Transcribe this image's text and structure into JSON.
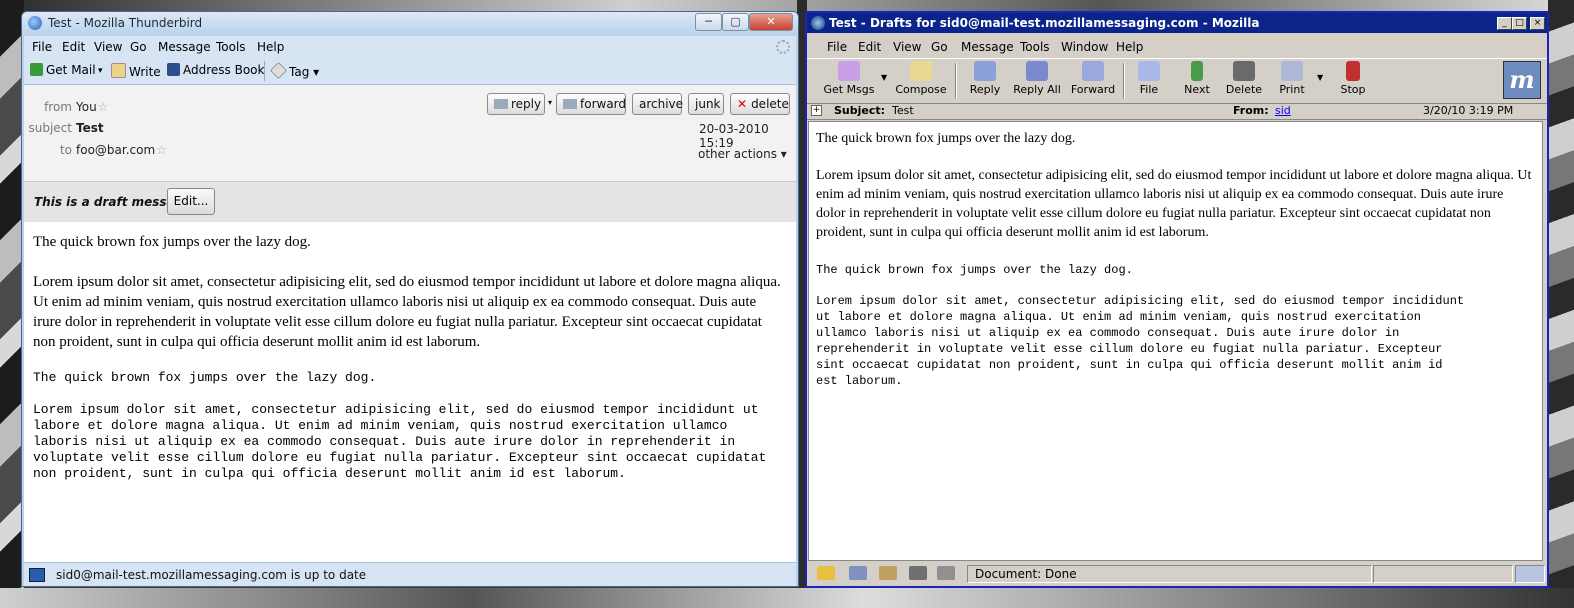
{
  "thunderbird": {
    "title": "Test - Mozilla Thunderbird",
    "caption": {
      "minimize": "─",
      "maximize": "▢",
      "close": "✕"
    },
    "menus": [
      "File",
      "Edit",
      "View",
      "Go",
      "Message",
      "Tools",
      "Help"
    ],
    "toolbar": {
      "get_mail": "Get Mail",
      "get_mail_drop": "▾",
      "write": "Write",
      "address_book": "Address Book",
      "tag": "Tag ▾"
    },
    "header": {
      "from_label": "from",
      "from_value": "You",
      "subject_label": "subject",
      "subject_value": "Test",
      "to_label": "to",
      "to_value": "foo@bar.com",
      "date": "20-03-2010 15:19",
      "other_actions": "other actions ▾",
      "star": "☆"
    },
    "buttons": {
      "reply": "reply",
      "reply_drop": "▾",
      "forward": "forward",
      "archive": "archive",
      "junk": "junk",
      "delete": "delete"
    },
    "draft_bar": {
      "message": "This is a draft message",
      "edit_button": "Edit..."
    },
    "body": {
      "p1": "The quick brown fox jumps over the lazy dog.",
      "p2": "Lorem ipsum dolor sit amet, consectetur adipisicing elit, sed do eiusmod tempor incididunt ut labore et dolore magna aliqua. Ut enim ad minim veniam, quis nostrud exercitation ullamco laboris nisi ut aliquip ex ea commodo consequat. Duis aute irure dolor in reprehenderit in voluptate velit esse cillum dolore eu fugiat nulla pariatur. Excepteur sint occaecat cupidatat non proident, sunt in culpa qui officia deserunt mollit anim id est laborum.",
      "p3": "The quick brown fox jumps over the lazy dog.",
      "p4": "Lorem ipsum dolor sit amet, consectetur adipisicing elit, sed do eiusmod tempor incididunt ut\nlabore et dolore magna aliqua. Ut enim ad minim veniam, quis nostrud exercitation ullamco\nlaboris nisi ut aliquip ex ea commodo consequat. Duis aute irure dolor in reprehenderit in\nvoluptate velit esse cillum dolore eu fugiat nulla pariatur. Excepteur sint occaecat cupidatat\nnon proident, sunt in culpa qui officia deserunt mollit anim id est laborum."
    },
    "status": "sid0@mail-test.mozillamessaging.com is up to date"
  },
  "mozilla": {
    "title": "Test - Drafts for sid0@mail-test.mozillamessaging.com - Mozilla",
    "caption": {
      "minimize": "_",
      "maximize": "□",
      "close": "×"
    },
    "menus": [
      "File",
      "Edit",
      "View",
      "Go",
      "Message",
      "Tools",
      "Window",
      "Help"
    ],
    "toolbar": {
      "get_msgs": "Get Msgs",
      "compose": "Compose",
      "reply": "Reply",
      "reply_all": "Reply All",
      "forward": "Forward",
      "file": "File",
      "next": "Next",
      "delete": "Delete",
      "print": "Print",
      "stop": "Stop",
      "drop": "▼",
      "throbber": "m"
    },
    "header": {
      "expand": "+",
      "subject_label": "Subject:",
      "subject_value": "Test",
      "from_label": "From:",
      "from_value": "sid",
      "date": "3/20/10 3:19 PM"
    },
    "body": {
      "p1": "The quick brown fox jumps over the lazy dog.",
      "p2": "Lorem ipsum dolor sit amet, consectetur adipisicing elit, sed do eiusmod tempor incididunt ut labore et dolore magna aliqua. Ut enim ad minim veniam, quis nostrud exercitation ullamco laboris nisi ut aliquip ex ea commodo consequat. Duis aute irure dolor in reprehenderit in voluptate velit esse cillum dolore eu fugiat nulla pariatur. Excepteur sint occaecat cupidatat non proident, sunt in culpa qui officia deserunt mollit anim id est laborum.",
      "p3": "The quick brown fox jumps over the lazy dog.",
      "p4": "Lorem ipsum dolor sit amet, consectetur adipisicing elit, sed do eiusmod tempor incididunt\nut labore et dolore magna aliqua. Ut enim ad minim veniam, quis nostrud exercitation\nullamco laboris nisi ut aliquip ex ea commodo consequat. Duis aute irure dolor in\nreprehenderit in voluptate velit esse cillum dolore eu fugiat nulla pariatur. Excepteur\nsint occaecat cupidatat non proident, sunt in culpa qui officia deserunt mollit anim id\nest laborum."
    },
    "status": "Document: Done"
  },
  "colors": {
    "tb_frame": "#b9d1ea",
    "mz_titlebar": "#0a248a",
    "mz_chrome": "#d4d0c8",
    "link": "#0000ff",
    "delete_x": "#d00000"
  }
}
